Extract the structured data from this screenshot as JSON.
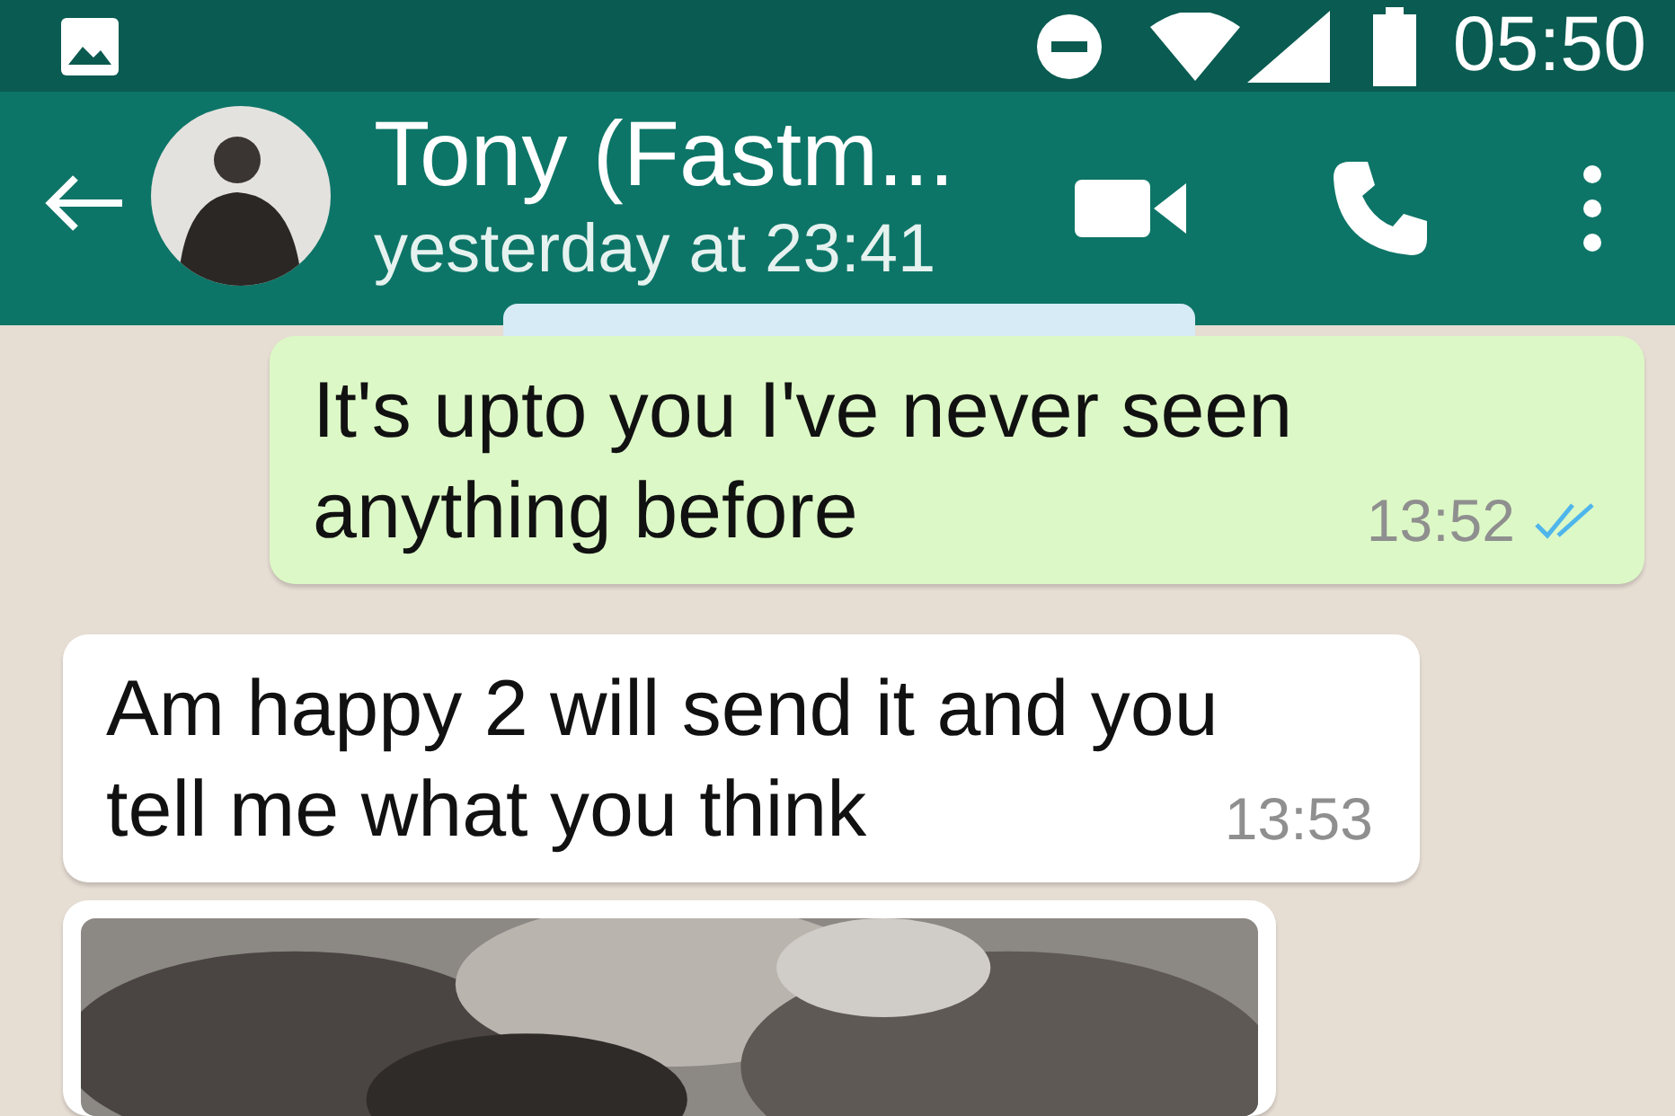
{
  "status_bar": {
    "time": "05:50"
  },
  "header": {
    "name": "Tony (Fastm...",
    "last_seen": "yesterday at 23:41"
  },
  "messages": [
    {
      "kind": "text",
      "sent": true,
      "text": "It's upto you I've never seen anything before",
      "time": "13:52",
      "read": true
    },
    {
      "kind": "text",
      "sent": false,
      "text": "Am happy 2 will send it and you tell me what you think",
      "time": "13:53"
    },
    {
      "kind": "picture",
      "sent": false
    }
  ]
}
